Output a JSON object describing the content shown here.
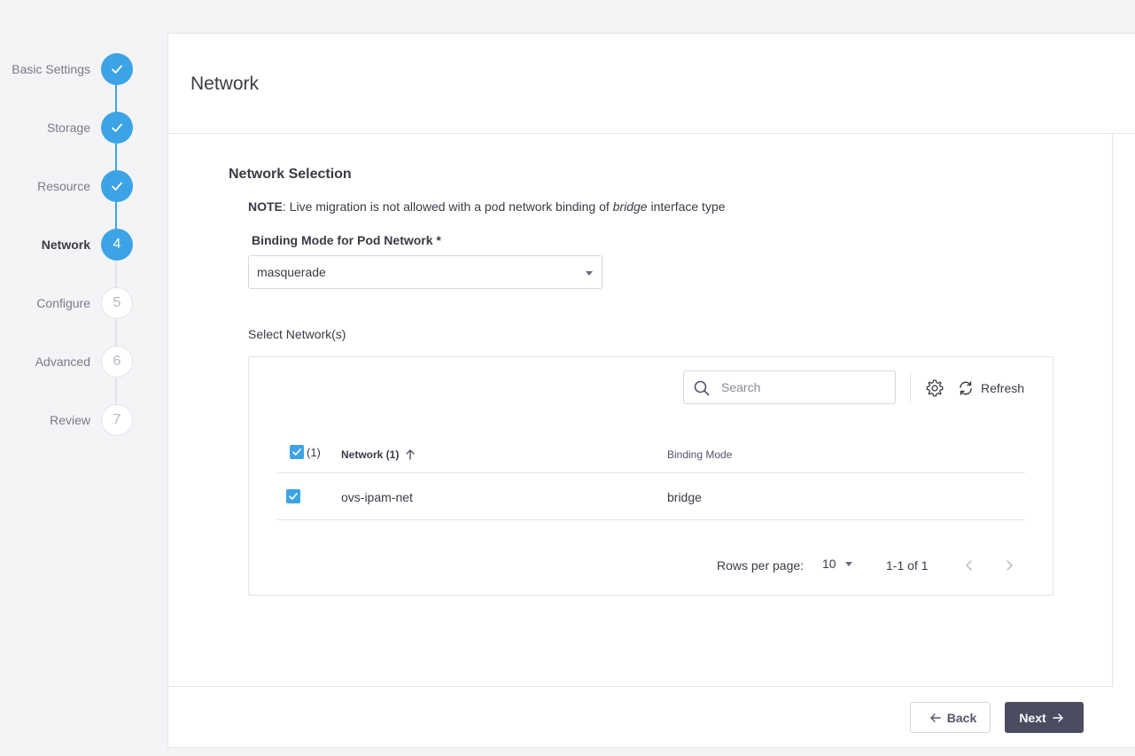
{
  "stepper": {
    "steps": [
      {
        "label": "Basic Settings",
        "number": "1",
        "state": "done"
      },
      {
        "label": "Storage",
        "number": "2",
        "state": "done"
      },
      {
        "label": "Resource",
        "number": "3",
        "state": "done"
      },
      {
        "label": "Network",
        "number": "4",
        "state": "current"
      },
      {
        "label": "Configure",
        "number": "5",
        "state": "todo"
      },
      {
        "label": "Advanced",
        "number": "6",
        "state": "todo"
      },
      {
        "label": "Review",
        "number": "7",
        "state": "todo"
      }
    ]
  },
  "page": {
    "title": "Network",
    "section_title": "Network Selection",
    "note": {
      "prefix": "NOTE",
      "text_before": ": Live migration is not allowed with a pod network binding of ",
      "emphasis": "bridge",
      "text_after": " interface type"
    },
    "binding_mode": {
      "label": "Binding Mode for Pod Network *",
      "value": "masquerade"
    },
    "select_networks_label": "Select Network(s)"
  },
  "table": {
    "search_placeholder": "Search",
    "refresh_label": "Refresh",
    "selected_count": "(1)",
    "columns": [
      "Network (1)",
      "Binding Mode"
    ],
    "rows": [
      {
        "network": "ovs-ipam-net",
        "binding_mode": "bridge",
        "checked": true
      }
    ],
    "pagination": {
      "rows_per_page_label": "Rows per page:",
      "rows_per_page": "10",
      "range": "1-1 of 1"
    }
  },
  "footer": {
    "back_label": "Back",
    "next_label": "Next"
  },
  "colors": {
    "accent": "#3ca4e6",
    "primary_button": "#4b4c60"
  }
}
